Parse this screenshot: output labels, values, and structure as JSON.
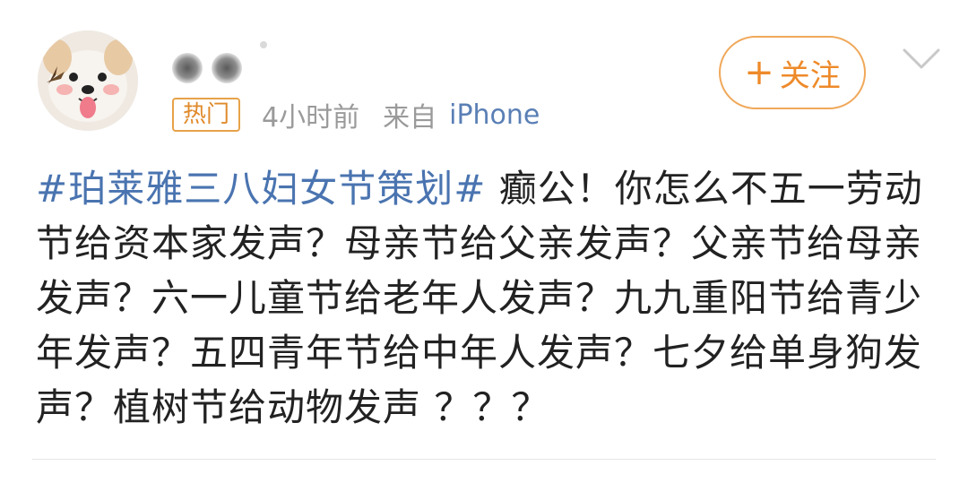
{
  "post": {
    "badge": "热门",
    "time": "4小时前",
    "source_prefix": "来自",
    "source_device": "iPhone",
    "hashtag": "#珀莱雅三八妇女节策划#",
    "text": " 癫公！你怎么不五一劳动节给资本家发声？母亲节给父亲发声？父亲节给母亲发声？六一儿童节给老年人发声？九九重阳节给青少年发声？五四青年节给中年人发声？七夕给单身狗发声？植树节给动物发声 ？？？"
  },
  "actions": {
    "follow_plus": "+",
    "follow_label": "关注"
  },
  "icons": {
    "avatar": "puppy-avatar",
    "more": "chevron-down-icon"
  },
  "colors": {
    "link": "#4a74b0",
    "accent": "#ee8a2a",
    "meta": "#9a9a9a"
  }
}
